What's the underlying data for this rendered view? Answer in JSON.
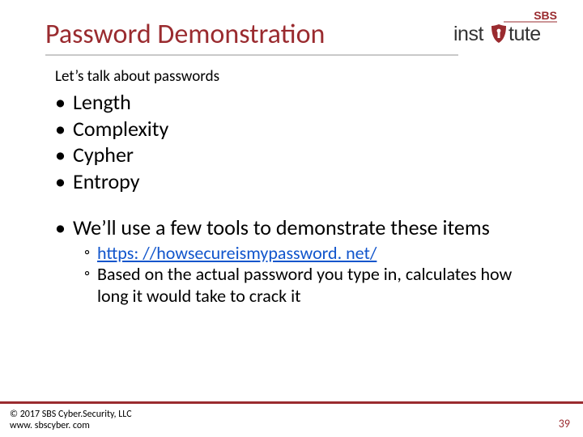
{
  "brand": {
    "top": "SBS",
    "word_left": "inst",
    "word_right": "tute",
    "accent": "#9a2b2f"
  },
  "title": "Password Demonstration",
  "intro": "Let’s talk about passwords",
  "bullets": [
    "Length",
    "Complexity",
    "Cypher",
    "Entropy"
  ],
  "tools_line": "We’ll use a few tools to demonstrate these items",
  "sub": {
    "link_text": "https: //howsecureismypassword. net/",
    "desc": "Based on the actual password you type in, calculates how long it would take to crack it"
  },
  "footer": {
    "copyright": "© 2017 SBS Cyber.Security, LLC",
    "url": "www. sbscyber. com",
    "page": "39"
  }
}
